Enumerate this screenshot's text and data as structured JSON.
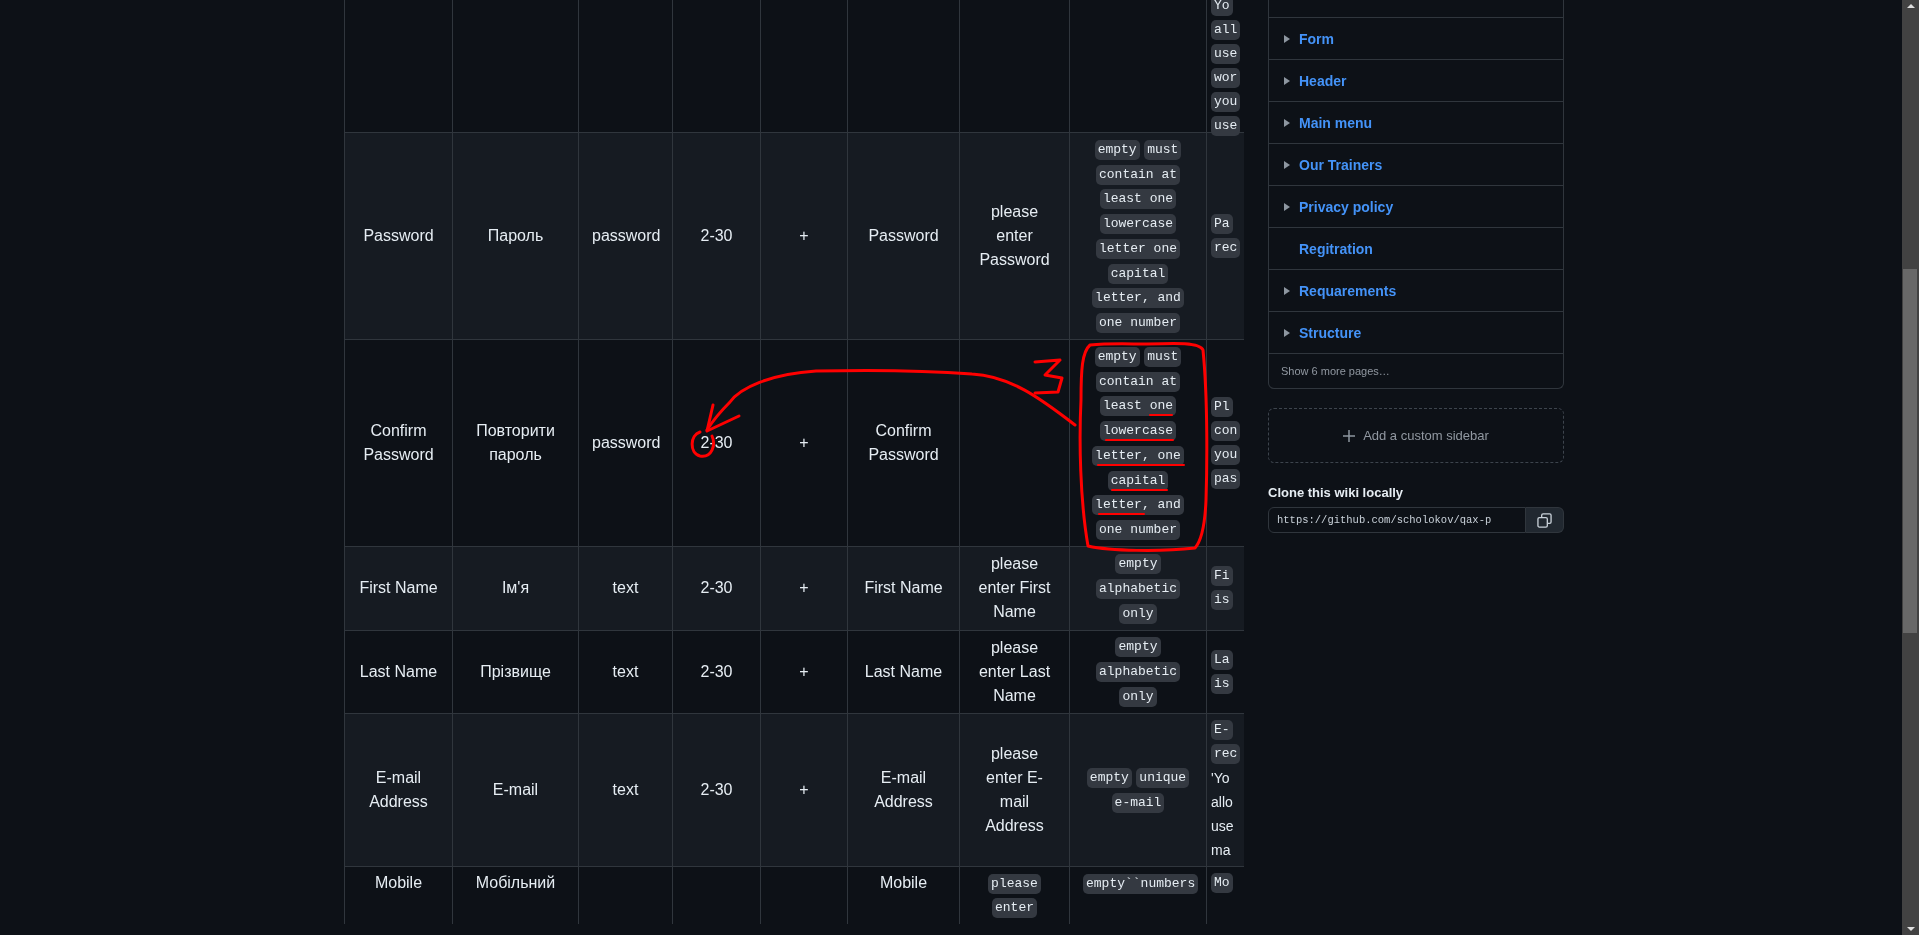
{
  "table": {
    "rows": [
      {
        "cells": [
          [],
          [],
          [],
          [],
          [],
          [],
          [],
          [],
          [
            {
              "text": "Yo",
              "kind": "code"
            },
            {
              "text": "all",
              "kind": "code"
            },
            {
              "text": "use",
              "kind": "code"
            },
            {
              "text": "wor",
              "kind": "code"
            },
            {
              "text": "you",
              "kind": "code"
            },
            {
              "text": "use",
              "kind": "code"
            }
          ]
        ]
      },
      {
        "cells": [
          [
            {
              "text": "Password",
              "kind": "plain"
            }
          ],
          [
            {
              "text": "Пароль",
              "kind": "plain"
            }
          ],
          [
            {
              "text": "password",
              "kind": "plain"
            }
          ],
          [
            {
              "text": "2-30",
              "kind": "plain"
            }
          ],
          [
            {
              "text": "+",
              "kind": "plain"
            }
          ],
          [
            {
              "text": "Password",
              "kind": "plain"
            }
          ],
          [
            {
              "text": "please enter Password",
              "kind": "plain"
            }
          ],
          [
            {
              "text": "empty",
              "kind": "code"
            },
            {
              "text": "must",
              "kind": "code"
            },
            {
              "text": "contain at",
              "kind": "code"
            },
            {
              "text": "least one",
              "kind": "code"
            },
            {
              "text": "lowercase",
              "kind": "code"
            },
            {
              "text": "letter one",
              "kind": "code"
            },
            {
              "text": "capital",
              "kind": "code"
            },
            {
              "text": "letter, and",
              "kind": "code"
            },
            {
              "text": "one number",
              "kind": "code"
            }
          ],
          [
            {
              "text": "Pa",
              "kind": "code"
            },
            {
              "text": "rec",
              "kind": "code"
            }
          ]
        ]
      },
      {
        "cells": [
          [
            {
              "text": "Confirm Password",
              "kind": "plain"
            }
          ],
          [
            {
              "text": "Повторити пароль",
              "kind": "plain"
            }
          ],
          [
            {
              "text": "password",
              "kind": "plain"
            }
          ],
          [
            {
              "text": "2-30",
              "kind": "plain"
            }
          ],
          [
            {
              "text": "+",
              "kind": "plain"
            }
          ],
          [
            {
              "text": "Confirm Password",
              "kind": "plain"
            }
          ],
          [],
          [
            {
              "text": "empty",
              "kind": "code"
            },
            {
              "text": "must",
              "kind": "code"
            },
            {
              "text": "contain at",
              "kind": "code"
            },
            {
              "text": "least one",
              "kind": "code"
            },
            {
              "text": "lowercase",
              "kind": "code"
            },
            {
              "text": "letter, one",
              "kind": "code"
            },
            {
              "text": "capital",
              "kind": "code"
            },
            {
              "text": "letter, and",
              "kind": "code"
            },
            {
              "text": "one number",
              "kind": "code"
            }
          ],
          [
            {
              "text": "Pl",
              "kind": "code"
            },
            {
              "text": "con",
              "kind": "code"
            },
            {
              "text": "you",
              "kind": "code"
            },
            {
              "text": "pas",
              "kind": "code"
            }
          ]
        ]
      },
      {
        "cells": [
          [
            {
              "text": "First Name",
              "kind": "plain"
            }
          ],
          [
            {
              "text": "Ім'я",
              "kind": "plain"
            }
          ],
          [
            {
              "text": "text",
              "kind": "plain"
            }
          ],
          [
            {
              "text": "2-30",
              "kind": "plain"
            }
          ],
          [
            {
              "text": "+",
              "kind": "plain"
            }
          ],
          [
            {
              "text": "First Name",
              "kind": "plain"
            }
          ],
          [
            {
              "text": "please enter First Name",
              "kind": "plain"
            }
          ],
          [
            {
              "text": "empty",
              "kind": "code"
            },
            {
              "text": "alphabetic",
              "kind": "code"
            },
            {
              "text": "only",
              "kind": "code"
            }
          ],
          [
            {
              "text": "Fi",
              "kind": "code"
            },
            {
              "text": "is",
              "kind": "code"
            }
          ]
        ]
      },
      {
        "cells": [
          [
            {
              "text": "Last Name",
              "kind": "plain"
            }
          ],
          [
            {
              "text": "Прізвище",
              "kind": "plain"
            }
          ],
          [
            {
              "text": "text",
              "kind": "plain"
            }
          ],
          [
            {
              "text": "2-30",
              "kind": "plain"
            }
          ],
          [
            {
              "text": "+",
              "kind": "plain"
            }
          ],
          [
            {
              "text": "Last Name",
              "kind": "plain"
            }
          ],
          [
            {
              "text": "please enter Last Name",
              "kind": "plain"
            }
          ],
          [
            {
              "text": "empty",
              "kind": "code"
            },
            {
              "text": "alphabetic",
              "kind": "code"
            },
            {
              "text": "only",
              "kind": "code"
            }
          ],
          [
            {
              "text": "La",
              "kind": "code"
            },
            {
              "text": "is",
              "kind": "code"
            }
          ]
        ]
      },
      {
        "cells": [
          [
            {
              "text": "E-mail Address",
              "kind": "plain"
            }
          ],
          [
            {
              "text": "E-mail",
              "kind": "plain"
            }
          ],
          [
            {
              "text": "text",
              "kind": "plain"
            }
          ],
          [
            {
              "text": "2-30",
              "kind": "plain"
            }
          ],
          [
            {
              "text": "+",
              "kind": "plain"
            }
          ],
          [
            {
              "text": "E-mail Address",
              "kind": "plain"
            }
          ],
          [
            {
              "text": "please enter E-mail Address",
              "kind": "plain"
            }
          ],
          [
            {
              "text": "empty",
              "kind": "code"
            },
            {
              "text": "unique",
              "kind": "code"
            },
            {
              "text": "e-mail",
              "kind": "code"
            }
          ],
          [
            {
              "text": "E-",
              "kind": "code"
            },
            {
              "text": "rec",
              "kind": "code"
            },
            {
              "text": "'Yo",
              "kind": "plain"
            },
            {
              "text": "allo",
              "kind": "plain"
            },
            {
              "text": "use",
              "kind": "plain"
            },
            {
              "text": "ma",
              "kind": "plain"
            }
          ]
        ]
      },
      {
        "cells": [
          [
            {
              "text": "Mobile",
              "kind": "plain"
            }
          ],
          [
            {
              "text": "Мобільний",
              "kind": "plain"
            }
          ],
          [],
          [],
          [],
          [
            {
              "text": "Mobile",
              "kind": "plain"
            }
          ],
          [
            {
              "text": "please",
              "kind": "code"
            },
            {
              "text": "enter",
              "kind": "code"
            }
          ],
          [
            {
              "text": "empty``numbers",
              "kind": "code"
            }
          ],
          [
            {
              "text": "Mo",
              "kind": "code"
            }
          ]
        ]
      }
    ]
  },
  "sidebar": {
    "pages": [
      {
        "label": "Form",
        "expandable": true
      },
      {
        "label": "Header",
        "expandable": true
      },
      {
        "label": "Main menu",
        "expandable": true
      },
      {
        "label": "Our Trainers",
        "expandable": true
      },
      {
        "label": "Privacy policy",
        "expandable": true
      },
      {
        "label": "Regitration",
        "expandable": false
      },
      {
        "label": "Requarements",
        "expandable": true
      },
      {
        "label": "Structure",
        "expandable": true
      }
    ],
    "show_more": "Show 6 more pages…",
    "add_sidebar": "Add a custom sidebar",
    "clone_title": "Clone this wiki locally",
    "clone_url": "https://github.com/scholokov/qax-p"
  }
}
